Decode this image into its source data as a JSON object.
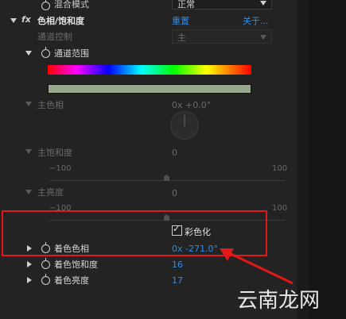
{
  "rows": {
    "blend_mode_label": "混合模式",
    "blend_mode_value": "正常",
    "fx_label": "fx",
    "effect_name": "色相/饱和度",
    "reset": "重置",
    "about": "关于...",
    "channel_control_label": "通道控制",
    "channel_control_value": "主",
    "channel_range_label": "通道范围",
    "master_hue_label": "主色相",
    "master_hue_value": "0x +0.0°",
    "master_sat_label": "主饱和度",
    "master_sat_value": "0",
    "master_light_label": "主亮度",
    "master_light_value": "0",
    "slider_min": "−100",
    "slider_max": "100",
    "colorize_label": "彩色化",
    "colorize_hue_label": "着色色相",
    "colorize_hue_value": "0x -271.0°",
    "colorize_sat_label": "着色饱和度",
    "colorize_sat_value": "16",
    "colorize_light_label": "着色亮度",
    "colorize_light_value": "17"
  },
  "checkbox_glyph": "✓",
  "watermark": "云南龙网",
  "colors": {
    "background": "#232323",
    "accent_blue": "#2d8ceb",
    "highlight_red": "#e01818",
    "range_bar_bottom": "#98a98e"
  },
  "state": {
    "colorize_checked": true,
    "colorize_hue_highlighted": true
  }
}
